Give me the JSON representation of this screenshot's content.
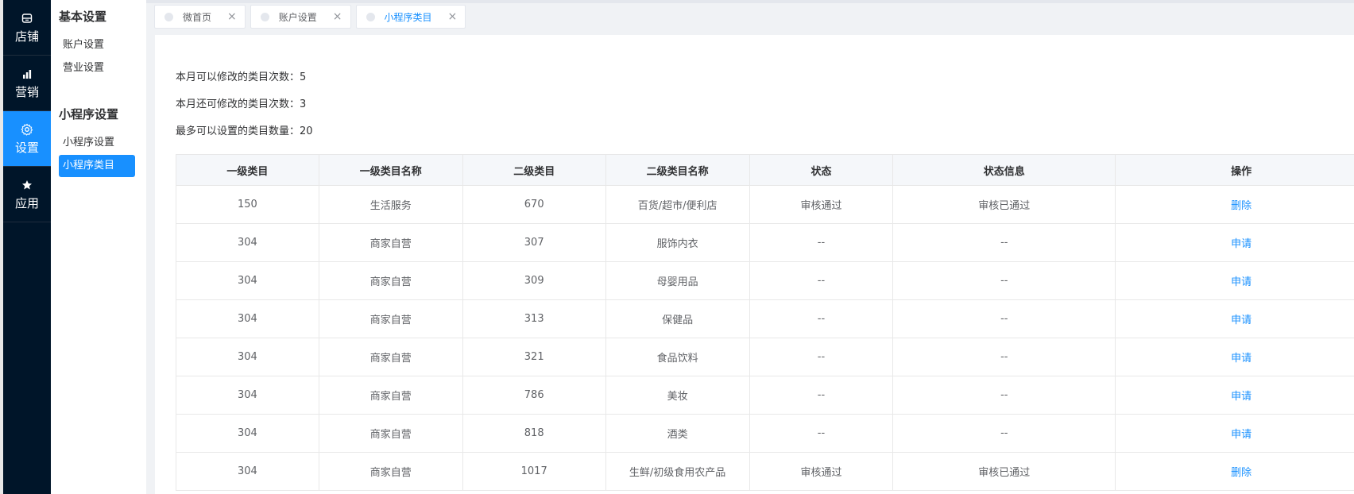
{
  "leftnav": {
    "items": [
      {
        "icon": "store-icon",
        "label": "店铺"
      },
      {
        "icon": "bar-chart-icon",
        "label": "营销"
      },
      {
        "icon": "gear-icon",
        "label": "设置"
      },
      {
        "icon": "star-icon",
        "label": "应用"
      }
    ],
    "active": "设置"
  },
  "subnav": {
    "groups": [
      {
        "title": "基本设置",
        "items": [
          "账户设置",
          "营业设置"
        ]
      },
      {
        "title": "小程序设置",
        "items": [
          "小程序设置",
          "小程序类目"
        ]
      }
    ],
    "active": "小程序类目"
  },
  "tabs": [
    {
      "label": "微首页",
      "close": "×"
    },
    {
      "label": "账户设置",
      "close": "×"
    },
    {
      "label": "小程序类目",
      "close": "×"
    }
  ],
  "active_tab": "小程序类目",
  "info": {
    "line1": "本月可以修改的类目次数：5",
    "line2": "本月还可修改的类目次数：3",
    "line3": "最多可以设置的类目数量：20"
  },
  "table": {
    "headers": [
      "一级类目",
      "一级类目名称",
      "二级类目",
      "二级类目名称",
      "状态",
      "状态信息",
      "操作"
    ],
    "rows": [
      [
        "150",
        "生活服务",
        "670",
        "百货/超市/便利店",
        "审核通过",
        "审核已通过",
        "删除"
      ],
      [
        "304",
        "商家自营",
        "307",
        "服饰内衣",
        "--",
        "--",
        "申请"
      ],
      [
        "304",
        "商家自营",
        "309",
        "母婴用品",
        "--",
        "--",
        "申请"
      ],
      [
        "304",
        "商家自营",
        "313",
        "保健品",
        "--",
        "--",
        "申请"
      ],
      [
        "304",
        "商家自营",
        "321",
        "食品饮料",
        "--",
        "--",
        "申请"
      ],
      [
        "304",
        "商家自营",
        "786",
        "美妆",
        "--",
        "--",
        "申请"
      ],
      [
        "304",
        "商家自营",
        "818",
        "酒类",
        "--",
        "--",
        "申请"
      ],
      [
        "304",
        "商家自营",
        "1017",
        "生鲜/初级食用农产品",
        "审核通过",
        "审核已通过",
        "删除"
      ]
    ]
  },
  "colors": {
    "nav_bg": "#001529",
    "accent": "#1890ff",
    "page_bg": "#f0f2f5"
  }
}
